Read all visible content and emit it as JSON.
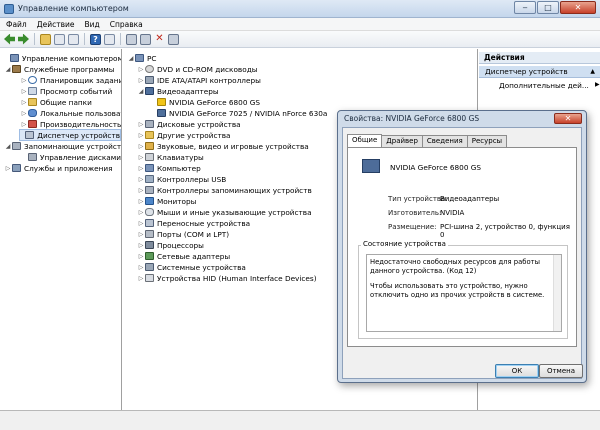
{
  "window": {
    "title": "Управление компьютером",
    "min": "‒",
    "max": "□",
    "close": "✕"
  },
  "menu": [
    "Файл",
    "Действие",
    "Вид",
    "Справка"
  ],
  "left_tree": [
    {
      "label": "Управление компьютером (л",
      "icon": "pc",
      "twisty": ""
    },
    {
      "label": "Служебные программы",
      "icon": "tool",
      "twisty": "◢"
    },
    {
      "label": "Планировщик заданий",
      "icon": "clock",
      "twisty": "▷"
    },
    {
      "label": "Просмотр событий",
      "icon": "log",
      "twisty": "▷"
    },
    {
      "label": "Общие папки",
      "icon": "share",
      "twisty": "▷"
    },
    {
      "label": "Локальные пользовате",
      "icon": "users",
      "twisty": "▷"
    },
    {
      "label": "Производительность",
      "icon": "perf",
      "twisty": "▷"
    },
    {
      "label": "Диспетчер устройств",
      "icon": "dev",
      "twisty": ""
    },
    {
      "label": "Запоминающие устройст",
      "icon": "disk",
      "twisty": "◢"
    },
    {
      "label": "Управление дисками",
      "icon": "disk",
      "twisty": ""
    },
    {
      "label": "Службы и приложения",
      "icon": "svc",
      "twisty": "▷"
    }
  ],
  "device_tree": [
    {
      "label": "PC",
      "icon": "pc",
      "twisty": "◢",
      "indent": 0
    },
    {
      "label": "DVD и CD-ROM дисководы",
      "icon": "dvd",
      "twisty": "▷",
      "indent": 1
    },
    {
      "label": "IDE ATA/ATAPI контроллеры",
      "icon": "ide",
      "twisty": "▷",
      "indent": 1
    },
    {
      "label": "Видеоадаптеры",
      "icon": "video",
      "twisty": "◢",
      "indent": 1
    },
    {
      "label": "NVIDIA GeForce 6800 GS",
      "icon": "warn",
      "twisty": "",
      "indent": 2
    },
    {
      "label": "NVIDIA GeForce 7025 / NVIDIA nForce 630a",
      "icon": "video",
      "twisty": "",
      "indent": 2
    },
    {
      "label": "Дисковые устройства",
      "icon": "disk",
      "twisty": "▷",
      "indent": 1
    },
    {
      "label": "Другие устройства",
      "icon": "other",
      "twisty": "▷",
      "indent": 1
    },
    {
      "label": "Звуковые, видео и игровые устройства",
      "icon": "sound",
      "twisty": "▷",
      "indent": 1
    },
    {
      "label": "Клавиатуры",
      "icon": "kbd",
      "twisty": "▷",
      "indent": 1
    },
    {
      "label": "Компьютер",
      "icon": "pc",
      "twisty": "▷",
      "indent": 1
    },
    {
      "label": "Контроллеры USB",
      "icon": "usb",
      "twisty": "▷",
      "indent": 1
    },
    {
      "label": "Контроллеры запоминающих устройств",
      "icon": "disk",
      "twisty": "▷",
      "indent": 1
    },
    {
      "label": "Мониторы",
      "icon": "mon",
      "twisty": "▷",
      "indent": 1
    },
    {
      "label": "Мыши и иные указывающие устройства",
      "icon": "mouse",
      "twisty": "▷",
      "indent": 1
    },
    {
      "label": "Переносные устройства",
      "icon": "dev",
      "twisty": "▷",
      "indent": 1
    },
    {
      "label": "Порты (COM и LPT)",
      "icon": "port",
      "twisty": "▷",
      "indent": 1
    },
    {
      "label": "Процессоры",
      "icon": "cpu",
      "twisty": "▷",
      "indent": 1
    },
    {
      "label": "Сетевые адаптеры",
      "icon": "net",
      "twisty": "▷",
      "indent": 1
    },
    {
      "label": "Системные устройства",
      "icon": "sys",
      "twisty": "▷",
      "indent": 1
    },
    {
      "label": "Устройства HID (Human Interface Devices)",
      "icon": "hid",
      "twisty": "▷",
      "indent": 1
    }
  ],
  "actions": {
    "header": "Действия",
    "selected": "Диспетчер устройств",
    "more": "Дополнительные дей...",
    "arrow_up": "▲",
    "arrow_right": "▶"
  },
  "dialog": {
    "title": "Свойства: NVIDIA GeForce 6800 GS",
    "close": "✕",
    "tabs": [
      "Общие",
      "Драйвер",
      "Сведения",
      "Ресурсы"
    ],
    "device_name": "NVIDIA GeForce 6800 GS",
    "props": [
      {
        "label": "Тип устройства:",
        "value": "Видеоадаптеры"
      },
      {
        "label": "Изготовитель:",
        "value": "NVIDIA"
      },
      {
        "label": "Размещение:",
        "value": "PCI-шина 2, устройство 0, функция 0"
      }
    ],
    "status_title": "Состояние устройства",
    "status_line1": "Недостаточно свободных ресурсов для работы данного устройства. (Код 12)",
    "status_line2": "Чтобы использовать это устройство, нужно отключить одно из прочих устройств в системе.",
    "ok": "ОК",
    "cancel": "Отмена"
  }
}
